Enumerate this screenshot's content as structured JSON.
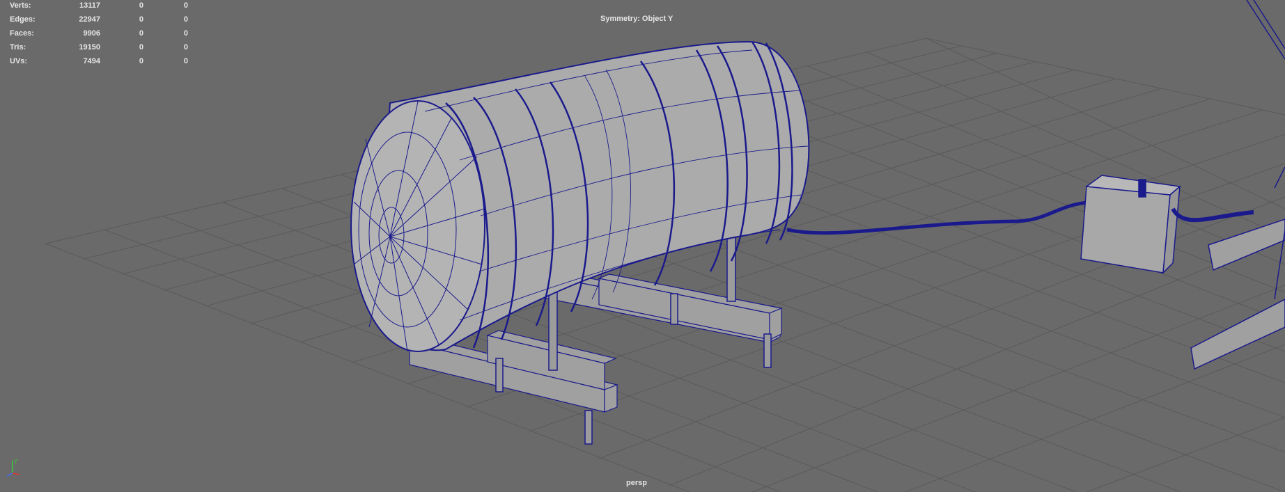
{
  "hud": {
    "stats": [
      {
        "label": "Verts:",
        "value": "13117",
        "c1": "0",
        "c2": "0"
      },
      {
        "label": "Edges:",
        "value": "22947",
        "c1": "0",
        "c2": "0"
      },
      {
        "label": "Faces:",
        "value": "9906",
        "c1": "0",
        "c2": "0"
      },
      {
        "label": "Tris:",
        "value": "19150",
        "c1": "0",
        "c2": "0"
      },
      {
        "label": "UVs:",
        "value": "7494",
        "c1": "0",
        "c2": "0"
      }
    ],
    "symmetry": "Symmetry: Object Y",
    "camera": "persp"
  },
  "axis": {
    "y": "Y"
  },
  "colors": {
    "background": "#6a6a6a",
    "grid": "#5a5a5a",
    "wire": "#1a1a8c",
    "mesh": "#a8a8a8",
    "hud_text": "#e6e6e6"
  }
}
